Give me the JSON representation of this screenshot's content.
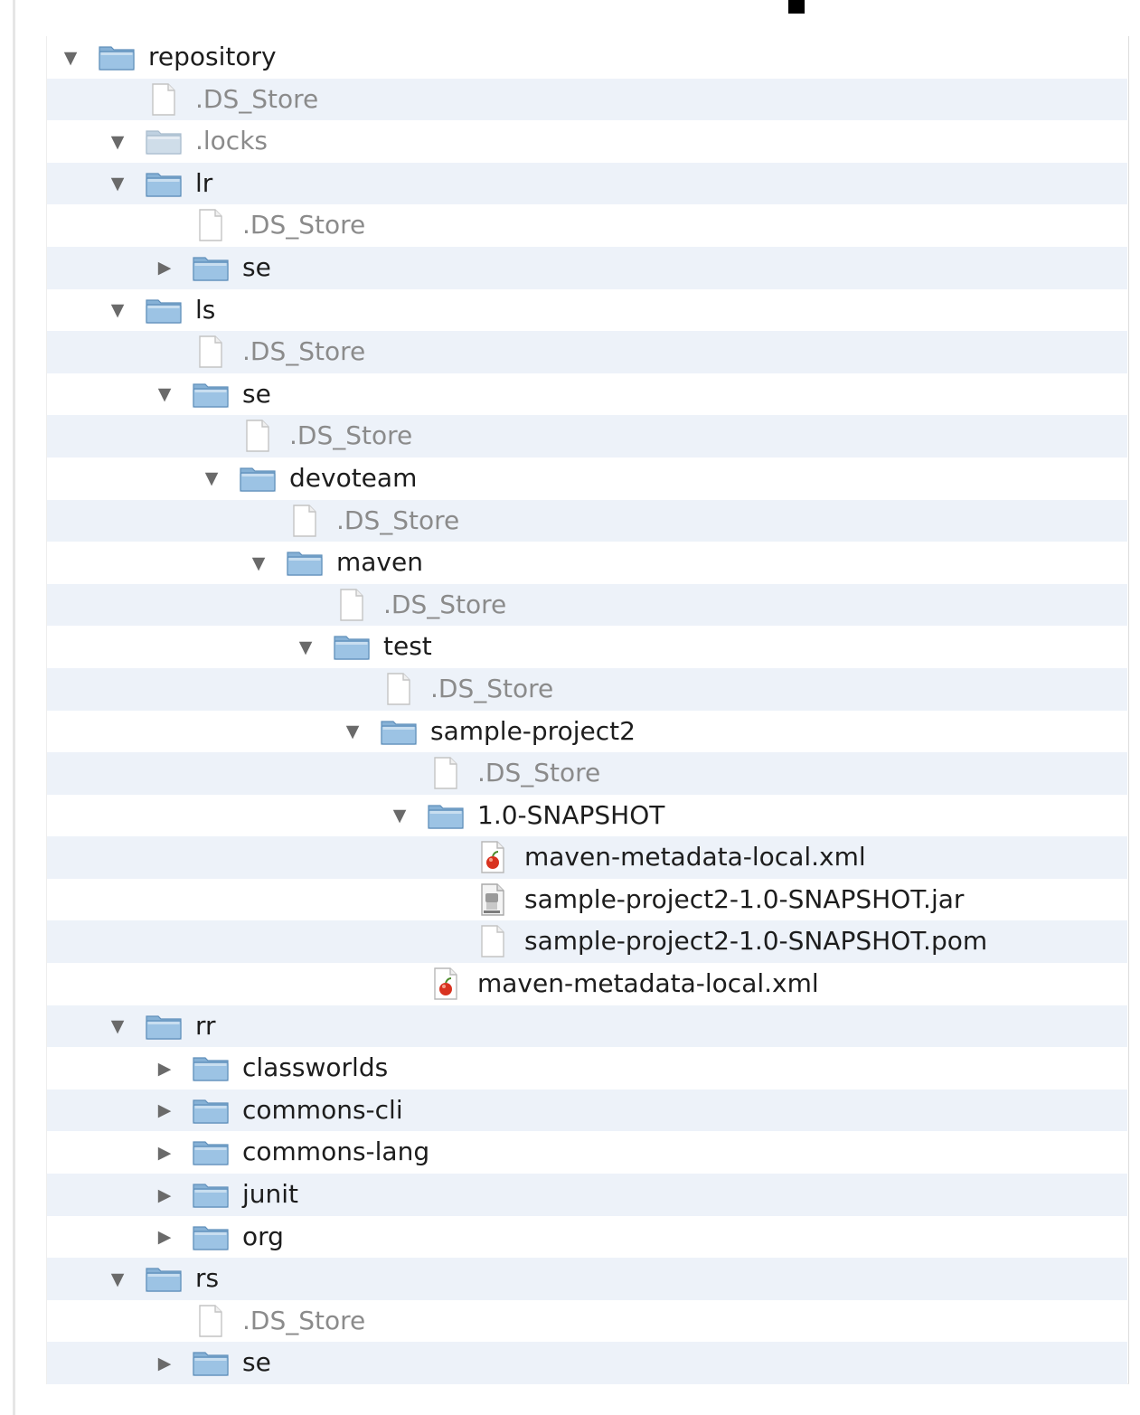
{
  "tree": {
    "rows": [
      {
        "label": "repository",
        "depth": 0,
        "kind": "folder",
        "disclosure": "expanded"
      },
      {
        "label": ".DS_Store",
        "depth": 1,
        "kind": "file",
        "disclosure": "none",
        "dim": true
      },
      {
        "label": ".locks",
        "depth": 1,
        "kind": "folder",
        "disclosure": "expanded",
        "dim": true
      },
      {
        "label": "lr",
        "depth": 1,
        "kind": "folder",
        "disclosure": "expanded"
      },
      {
        "label": ".DS_Store",
        "depth": 2,
        "kind": "file",
        "disclosure": "none",
        "dim": true
      },
      {
        "label": "se",
        "depth": 2,
        "kind": "folder",
        "disclosure": "collapsed"
      },
      {
        "label": "ls",
        "depth": 1,
        "kind": "folder",
        "disclosure": "expanded"
      },
      {
        "label": ".DS_Store",
        "depth": 2,
        "kind": "file",
        "disclosure": "none",
        "dim": true
      },
      {
        "label": "se",
        "depth": 2,
        "kind": "folder",
        "disclosure": "expanded"
      },
      {
        "label": ".DS_Store",
        "depth": 3,
        "kind": "file",
        "disclosure": "none",
        "dim": true
      },
      {
        "label": "devoteam",
        "depth": 3,
        "kind": "folder",
        "disclosure": "expanded"
      },
      {
        "label": ".DS_Store",
        "depth": 4,
        "kind": "file",
        "disclosure": "none",
        "dim": true
      },
      {
        "label": "maven",
        "depth": 4,
        "kind": "folder",
        "disclosure": "expanded"
      },
      {
        "label": ".DS_Store",
        "depth": 5,
        "kind": "file",
        "disclosure": "none",
        "dim": true
      },
      {
        "label": "test",
        "depth": 5,
        "kind": "folder",
        "disclosure": "expanded"
      },
      {
        "label": ".DS_Store",
        "depth": 6,
        "kind": "file",
        "disclosure": "none",
        "dim": true
      },
      {
        "label": "sample-project2",
        "depth": 6,
        "kind": "folder",
        "disclosure": "expanded"
      },
      {
        "label": ".DS_Store",
        "depth": 7,
        "kind": "file",
        "disclosure": "none",
        "dim": true
      },
      {
        "label": "1.0-SNAPSHOT",
        "depth": 7,
        "kind": "folder",
        "disclosure": "expanded"
      },
      {
        "label": "maven-metadata-local.xml",
        "depth": 8,
        "kind": "xml",
        "disclosure": "none"
      },
      {
        "label": "sample-project2-1.0-SNAPSHOT.jar",
        "depth": 8,
        "kind": "jar",
        "disclosure": "none"
      },
      {
        "label": "sample-project2-1.0-SNAPSHOT.pom",
        "depth": 8,
        "kind": "file",
        "disclosure": "none"
      },
      {
        "label": "maven-metadata-local.xml",
        "depth": 7,
        "kind": "xml",
        "disclosure": "none"
      },
      {
        "label": "rr",
        "depth": 1,
        "kind": "folder",
        "disclosure": "expanded"
      },
      {
        "label": "classworlds",
        "depth": 2,
        "kind": "folder",
        "disclosure": "collapsed"
      },
      {
        "label": "commons-cli",
        "depth": 2,
        "kind": "folder",
        "disclosure": "collapsed"
      },
      {
        "label": "commons-lang",
        "depth": 2,
        "kind": "folder",
        "disclosure": "collapsed"
      },
      {
        "label": "junit",
        "depth": 2,
        "kind": "folder",
        "disclosure": "collapsed"
      },
      {
        "label": "org",
        "depth": 2,
        "kind": "folder",
        "disclosure": "collapsed"
      },
      {
        "label": "rs",
        "depth": 1,
        "kind": "folder",
        "disclosure": "expanded"
      },
      {
        "label": ".DS_Store",
        "depth": 2,
        "kind": "file",
        "disclosure": "none",
        "dim": true
      },
      {
        "label": "se",
        "depth": 2,
        "kind": "folder",
        "disclosure": "collapsed"
      }
    ]
  },
  "colors": {
    "stripe": "#edf2f9",
    "folder": "#9cc3e4",
    "dim_text": "#8b8b8b"
  }
}
